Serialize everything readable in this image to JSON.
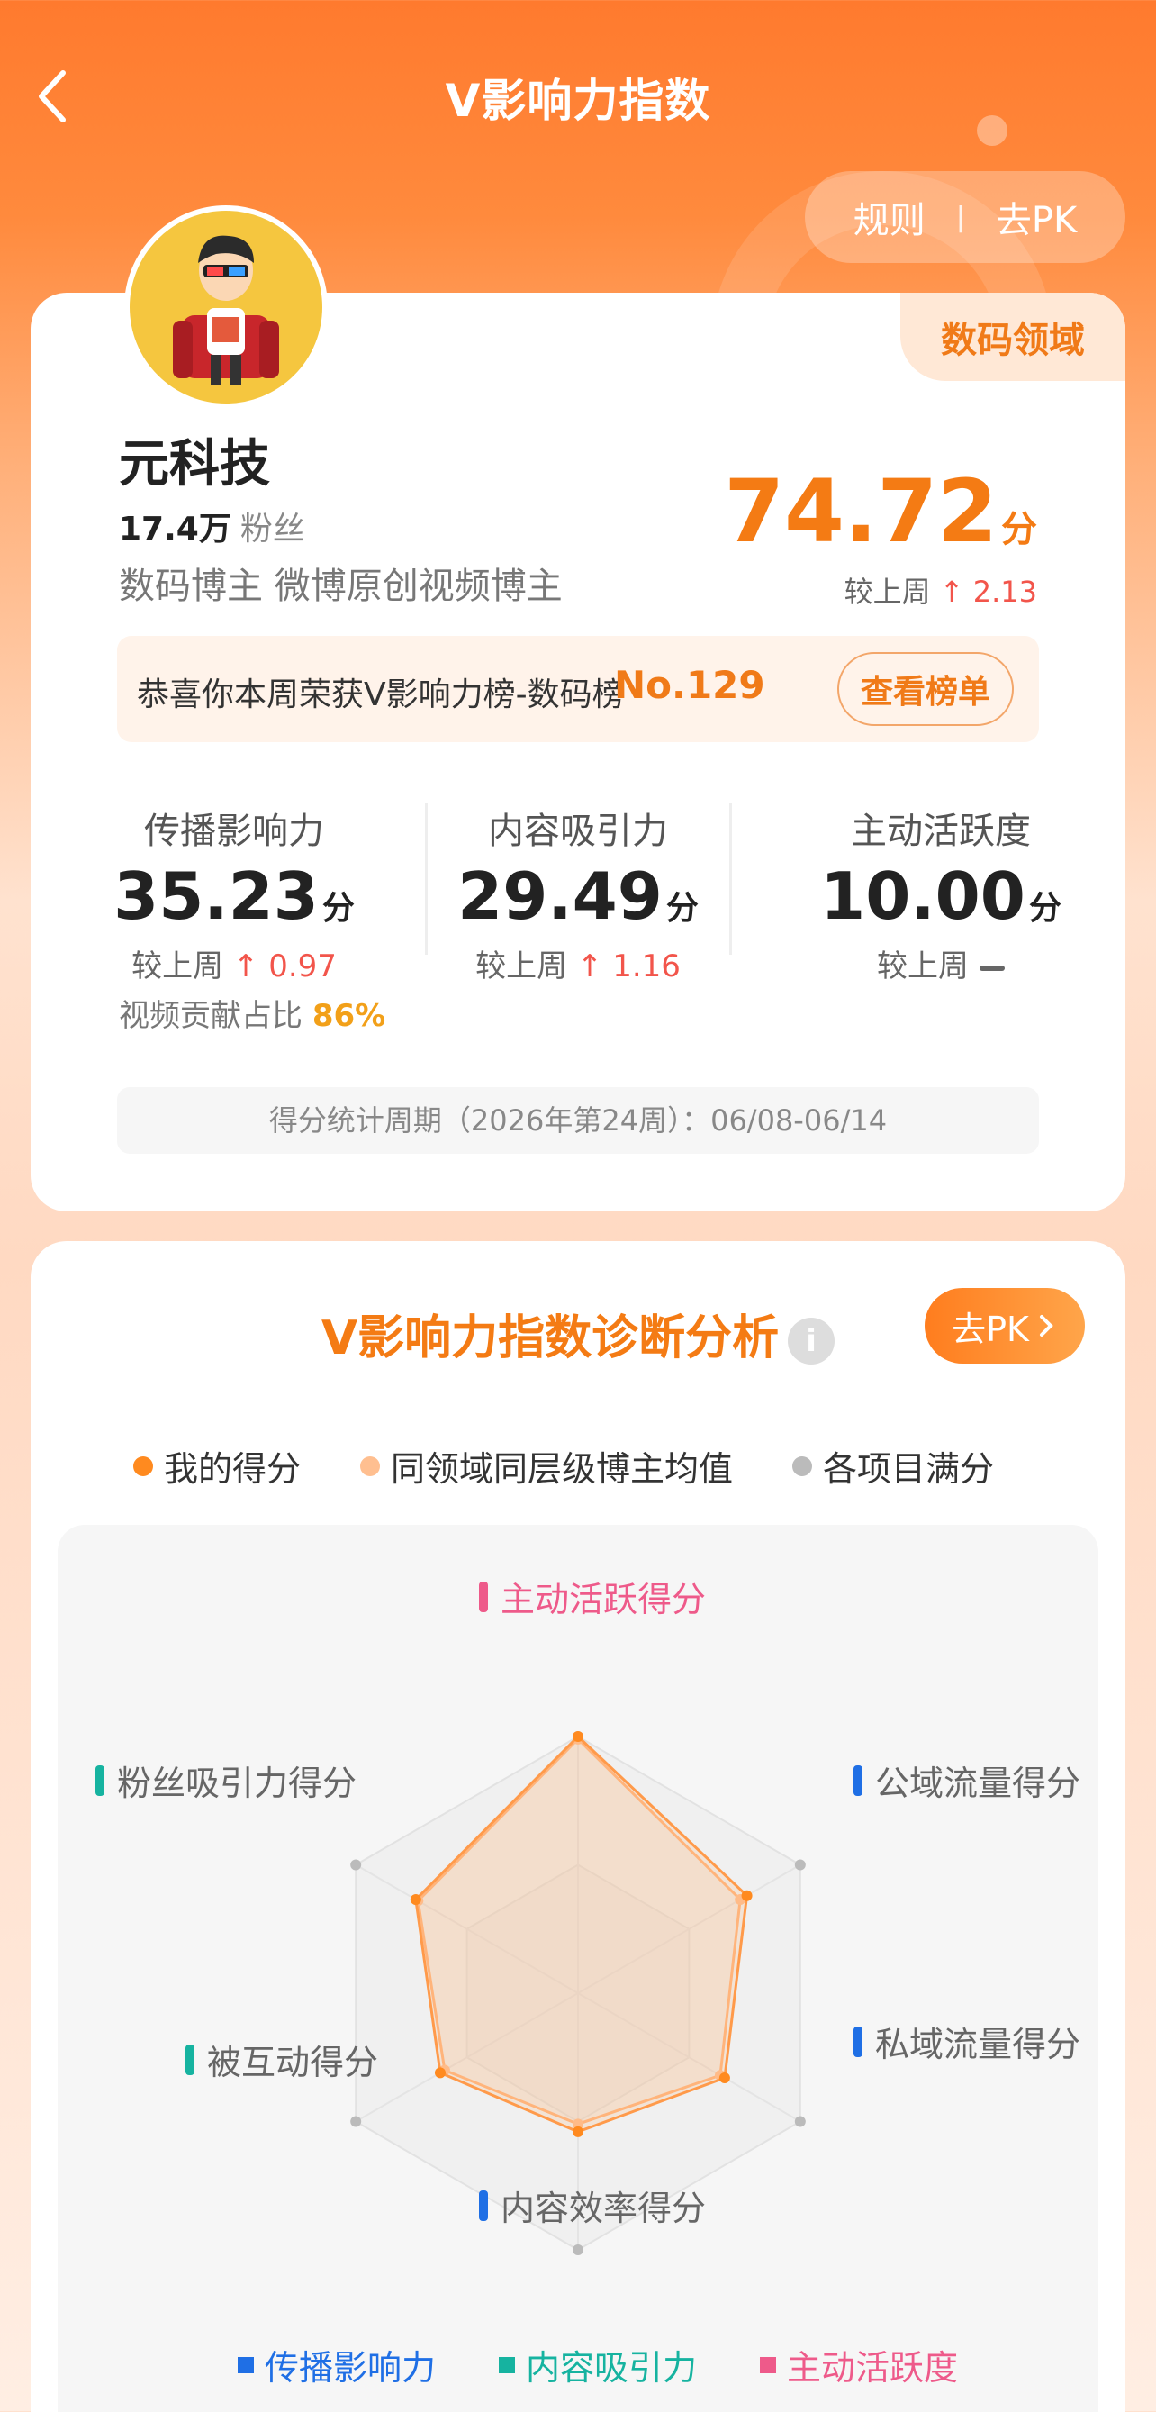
{
  "header": {
    "title": "V影响力指数",
    "rules_label": "规则",
    "pk_label": "去PK"
  },
  "profile": {
    "domain_tag": "数码领域",
    "name": "元科技",
    "fans_count": "17.4万",
    "fans_label": "粉丝",
    "bio": "数码博主 微博原创视频博主",
    "score": "74.72",
    "score_unit": "分",
    "delta_label": "较上周",
    "delta_value": "2.13"
  },
  "honor": {
    "text": "恭喜你本周荣获V影响力榜-数码榜",
    "rank": "No.129",
    "button": "查看榜单"
  },
  "metrics": [
    {
      "title": "传播影响力",
      "value": "35.23",
      "unit": "分",
      "delta_label": "较上周",
      "delta": "0.97"
    },
    {
      "title": "内容吸引力",
      "value": "29.49",
      "unit": "分",
      "delta_label": "较上周",
      "delta": "1.16"
    },
    {
      "title": "主动活跃度",
      "value": "10.00",
      "unit": "分",
      "delta_label": "较上周",
      "delta": ""
    }
  ],
  "video_share": {
    "label": "视频贡献占比",
    "value": "86%"
  },
  "period": "得分统计周期（2026年第24周）：06/08-06/14",
  "diagnosis": {
    "title": "V影响力指数诊断分析",
    "info": "i",
    "pk_button": "去PK",
    "legend": [
      {
        "label": "我的得分",
        "color": "#ff8a1f"
      },
      {
        "label": "同领域同层级博主均值",
        "color": "#ffbf90"
      },
      {
        "label": "各项目满分",
        "color": "#bbbbbb"
      }
    ],
    "radar_labels": [
      {
        "label": "主动活跃得分",
        "color": "#ee5a8a",
        "text_color": "#ee5a8a"
      },
      {
        "label": "公域流量得分",
        "color": "#1f6fe5",
        "text_color": "#666666"
      },
      {
        "label": "私域流量得分",
        "color": "#1f6fe5",
        "text_color": "#666666"
      },
      {
        "label": "内容效率得分",
        "color": "#1f6fe5",
        "text_color": "#666666"
      },
      {
        "label": "被互动得分",
        "color": "#16b3a0",
        "text_color": "#666666"
      },
      {
        "label": "粉丝吸引力得分",
        "color": "#16b3a0",
        "text_color": "#666666"
      }
    ],
    "category_legend": [
      {
        "label": "传播影响力",
        "color": "#1f6fe5"
      },
      {
        "label": "内容吸引力",
        "color": "#16b3a0"
      },
      {
        "label": "主动活跃度",
        "color": "#ee5a8a"
      }
    ]
  },
  "chart_data": {
    "type": "radar",
    "axes": [
      "主动活跃得分",
      "公域流量得分",
      "私域流量得分",
      "内容效率得分",
      "被互动得分",
      "粉丝吸引力得分"
    ],
    "range": [
      0,
      1
    ],
    "series": [
      {
        "name": "我的得分",
        "values": [
          1.0,
          0.76,
          0.66,
          0.54,
          0.62,
          0.73
        ]
      },
      {
        "name": "同领域同层级博主均值",
        "values": [
          0.99,
          0.73,
          0.64,
          0.51,
          0.6,
          0.72
        ]
      },
      {
        "name": "各项目满分",
        "values": [
          1,
          1,
          1,
          1,
          1,
          1
        ]
      }
    ]
  }
}
